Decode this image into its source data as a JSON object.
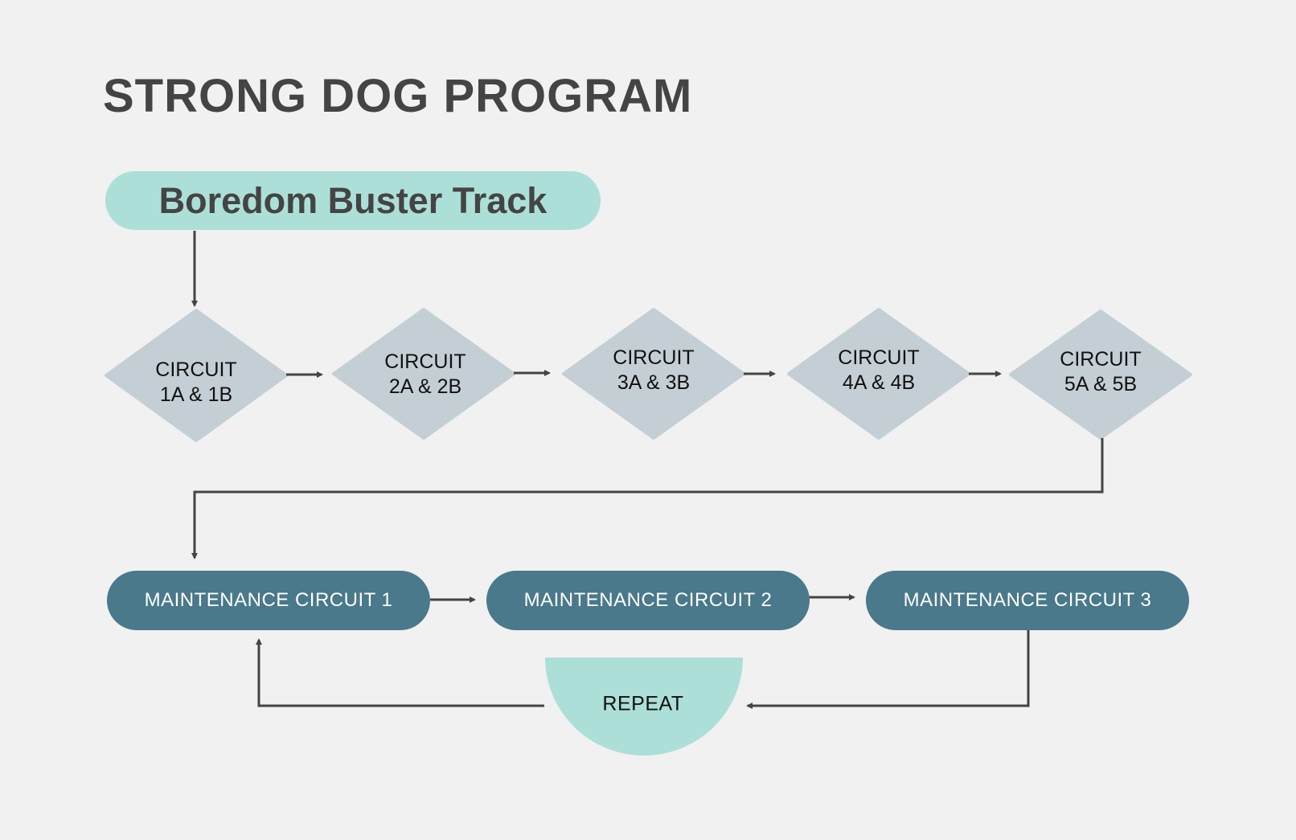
{
  "title": "STRONG DOG PROGRAM",
  "track": "Boredom Buster Track",
  "circuits": [
    {
      "line1": "CIRCUIT",
      "line2": "1A & 1B"
    },
    {
      "line1": "CIRCUIT",
      "line2": "2A & 2B"
    },
    {
      "line1": "CIRCUIT",
      "line2": "3A & 3B"
    },
    {
      "line1": "CIRCUIT",
      "line2": "4A & 4B"
    },
    {
      "line1": "CIRCUIT",
      "line2": "5A & 5B"
    }
  ],
  "maintenance": [
    "MAINTENANCE CIRCUIT 1",
    "MAINTENANCE CIRCUIT 2",
    "MAINTENANCE CIRCUIT 3"
  ],
  "repeat": "REPEAT",
  "colors": {
    "background": "#f1f1f1",
    "text_dark": "#444444",
    "track_fill": "#acdfd8",
    "diamond_fill": "#c4cfd5",
    "pill_fill": "#49798a",
    "repeat_fill": "#acdfd8",
    "connector": "#444444"
  }
}
